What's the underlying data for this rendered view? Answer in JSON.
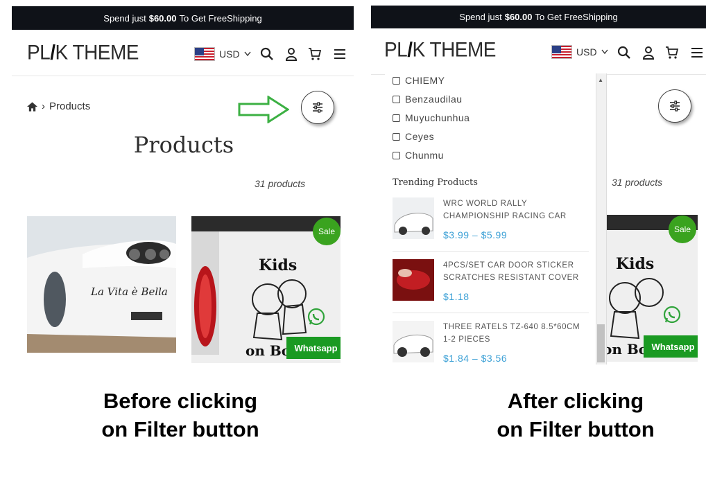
{
  "banner": {
    "pre": "Spend just",
    "amount": "$60.00",
    "post": "To Get FreeShipping"
  },
  "logo": {
    "part1": "PL",
    "part2": "K THEME"
  },
  "currency": {
    "code": "USD"
  },
  "breadcrumb": {
    "current": "Products"
  },
  "page": {
    "title": "Products",
    "count": "31 products"
  },
  "badges": {
    "sale": "Sale",
    "whatsapp": "Whatsapp"
  },
  "product_left_text": "La Vita è Bella",
  "sticker_text": {
    "top": "Kids",
    "bottom": "on Bo"
  },
  "drawer": {
    "brands": [
      "CHIEMY",
      "Benzaudilau",
      "Muyuchunhua",
      "Ceyes",
      "Chunmu"
    ],
    "trending_title": "Trending Products",
    "trending": [
      {
        "name": "WRC WORLD RALLY CHAMPIONSHIP RACING CAR",
        "price": "$3.99 – $5.99"
      },
      {
        "name": "4PCS/SET CAR DOOR STICKER SCRATCHES RESISTANT COVER",
        "price": "$1.18"
      },
      {
        "name": "THREE RATELS TZ-640 8.5*60CM 1-2 PIECES",
        "price": "$1.84 – $3.56"
      }
    ]
  },
  "captions": {
    "left": [
      "Before clicking",
      "on Filter button"
    ],
    "right": [
      "After clicking",
      "on Filter button"
    ]
  },
  "colors": {
    "banner": "#0f1218",
    "sale": "#3aa31f",
    "whatsapp": "#1a9a22",
    "price": "#3da1d6",
    "arrow": "#3cb043"
  },
  "icons": [
    "search-icon",
    "user-icon",
    "cart-icon",
    "menu-icon",
    "home-icon",
    "filter-icon",
    "whatsapp-icon",
    "arrow-right-icon",
    "chevron-down-icon"
  ]
}
